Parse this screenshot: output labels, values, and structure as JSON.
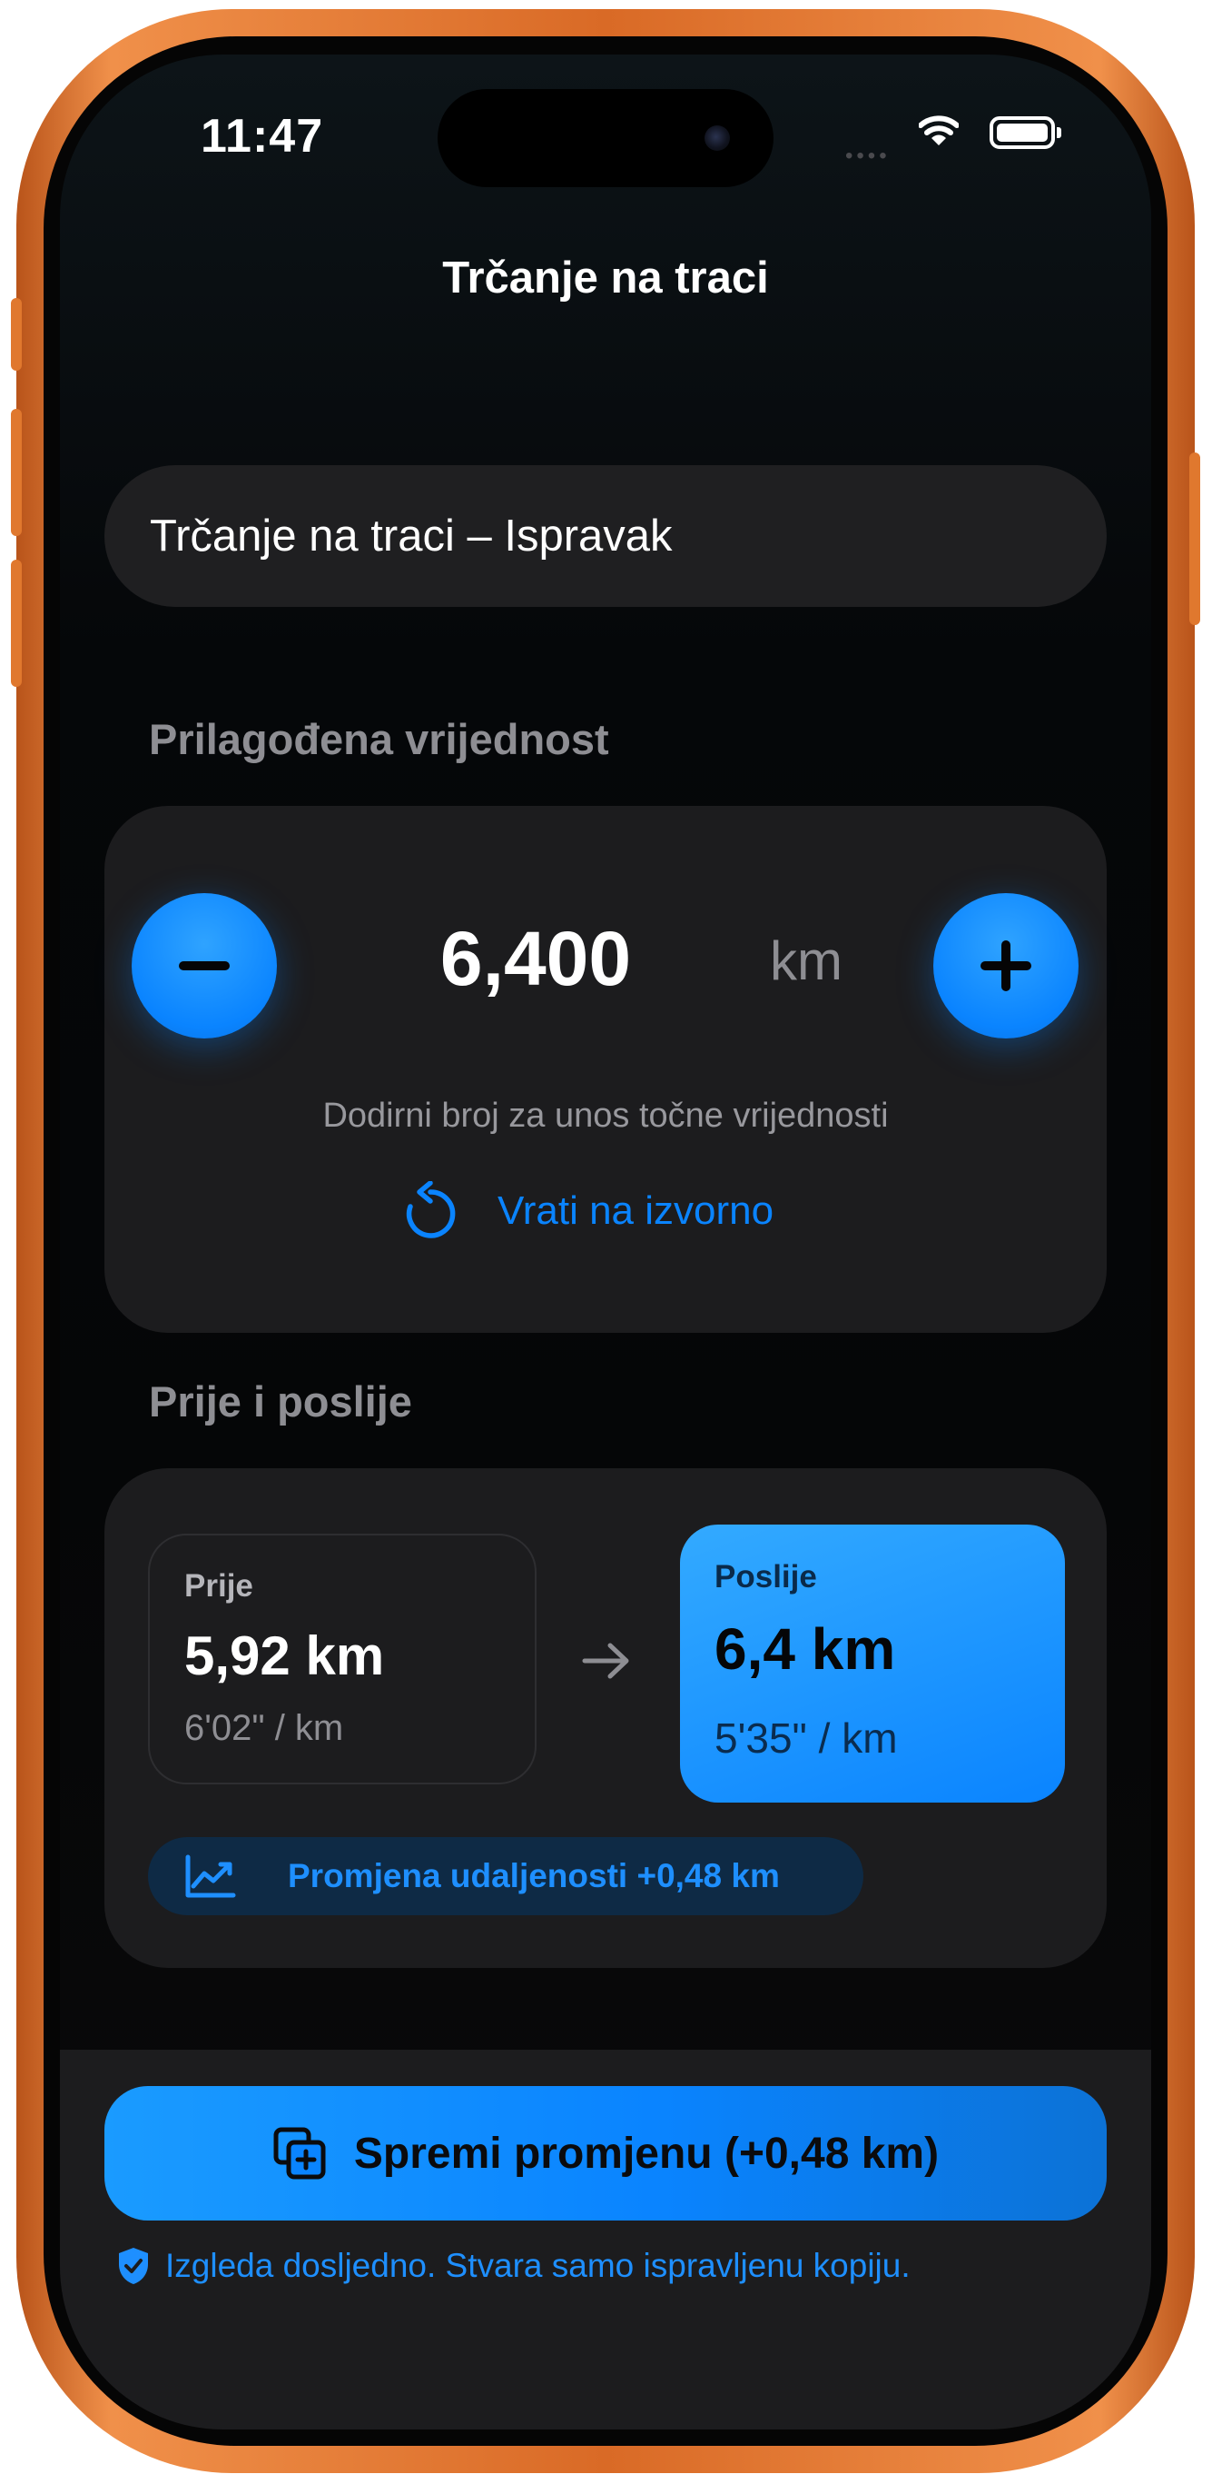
{
  "status_bar": {
    "time": "11:47",
    "signal_dots": "••••",
    "icons": [
      "wifi-icon",
      "battery-icon"
    ]
  },
  "nav": {
    "title": "Trčanje na traci"
  },
  "name_field": {
    "value": "Trčanje na traci – Ispravak"
  },
  "custom_value": {
    "section_label": "Prilagođena vrijednost",
    "minus_icon": "minus-icon",
    "plus_icon": "plus-icon",
    "value": "6,400",
    "unit": "km",
    "hint": "Dodirni broj za unos točne vrijednosti",
    "reset_icon": "reset-icon",
    "reset_label": "Vrati na izvorno"
  },
  "before_after": {
    "section_label": "Prije i poslije",
    "before": {
      "caption": "Prije",
      "value": "5,92 km",
      "pace": "6'02\" / km"
    },
    "arrow_icon": "arrow-right-icon",
    "after": {
      "caption": "Poslije",
      "value": "6,4 km",
      "pace": "5'35\" / km"
    },
    "change_icon": "trend-up-icon",
    "change_label": "Promjena udaljenosti +0,48 km"
  },
  "footer": {
    "save_icon": "duplicate-plus-icon",
    "save_label": "Spremi promjenu (+0,48 km)",
    "shield_icon": "shield-check-icon",
    "note": "Izgleda dosljedno. Stvara samo ispravljenu kopiju."
  },
  "colors": {
    "accent": "#0a84ff",
    "frame": "#e0782e",
    "card_bg": "#1c1c1e",
    "screen_bg": "#050607"
  }
}
